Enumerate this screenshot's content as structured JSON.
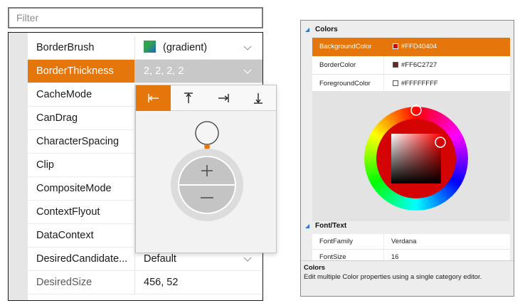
{
  "filter": {
    "placeholder": "Filter"
  },
  "properties": [
    {
      "name": "BorderBrush",
      "value": "(gradient)"
    },
    {
      "name": "BorderThickness",
      "value": "2, 2, 2, 2"
    },
    {
      "name": "CacheMode",
      "value": ""
    },
    {
      "name": "CanDrag",
      "value": ""
    },
    {
      "name": "CharacterSpacing",
      "value": ""
    },
    {
      "name": "Clip",
      "value": ""
    },
    {
      "name": "CompositeMode",
      "value": ""
    },
    {
      "name": "ContextFlyout",
      "value": ""
    },
    {
      "name": "DataContext",
      "value": ""
    },
    {
      "name": "DesiredCandidate...",
      "value": "Default"
    },
    {
      "name": "DesiredSize",
      "value": "456, 52"
    }
  ],
  "popup": {
    "sides": [
      "left-edge-icon",
      "top-edge-icon",
      "right-edge-icon",
      "bottom-edge-icon"
    ],
    "active_side": "left-edge-icon",
    "plus": "+",
    "minus": "−"
  },
  "colors": {
    "category": "Colors",
    "rows": [
      {
        "name": "BackgroundColor",
        "value": "#FFD40404",
        "swatch": "#d40404"
      },
      {
        "name": "BorderColor",
        "value": "#FF6C2727",
        "swatch": "#6c2727"
      },
      {
        "name": "ForegroundColor",
        "value": "#FFFFFFFF",
        "swatch": "#ffffff"
      }
    ],
    "selected_hue": "#ff0000"
  },
  "font_text": {
    "category": "Font/Text",
    "rows": [
      {
        "name": "FontFamily",
        "value": "Verdana"
      },
      {
        "name": "FontSize",
        "value": "16"
      }
    ]
  },
  "description": {
    "title": "Colors",
    "text": "Edit multiple Color properties using a single category editor."
  },
  "accent": "#e5760c"
}
